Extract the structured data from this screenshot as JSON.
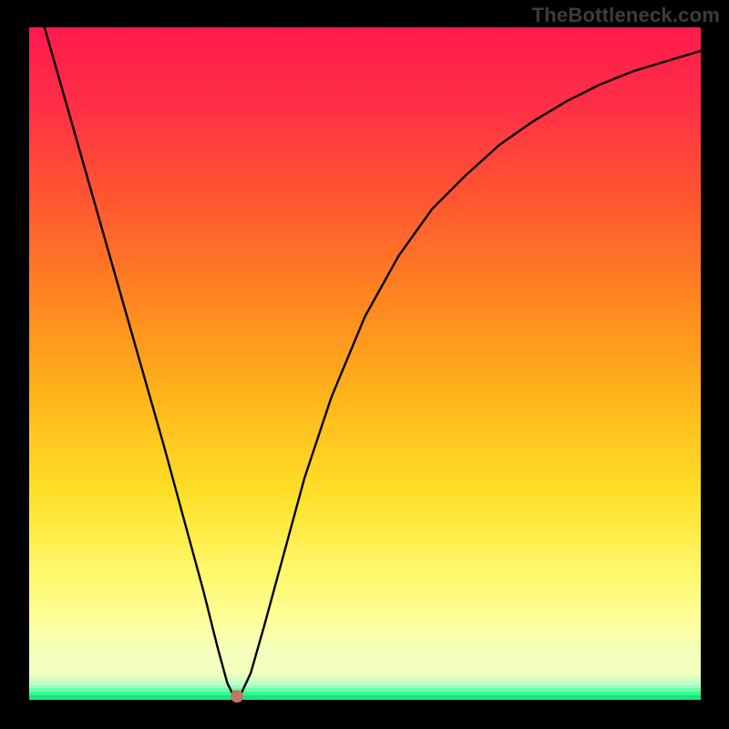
{
  "watermark": "TheBottleneck.com",
  "chart_data": {
    "type": "line",
    "title": "",
    "xlabel": "",
    "ylabel": "",
    "xlim": [
      0,
      100
    ],
    "ylim": [
      0,
      100
    ],
    "series": [
      {
        "name": "curve",
        "x": [
          0,
          4,
          8,
          12,
          16,
          20,
          23,
          26,
          28,
          29.5,
          30.5,
          31.5,
          33,
          35,
          38,
          41,
          45,
          50,
          55,
          60,
          65,
          70,
          75,
          80,
          85,
          90,
          95,
          100
        ],
        "y": [
          108,
          94,
          80,
          66,
          52,
          38,
          27,
          16,
          8,
          2.5,
          0.5,
          0.8,
          4,
          11,
          22,
          33,
          45,
          57,
          66,
          73,
          78,
          82.5,
          86,
          89,
          91.5,
          93.5,
          95,
          96.5
        ]
      }
    ],
    "marker": {
      "x": 31,
      "y": 0.5,
      "color": "#c37664"
    },
    "gradient_bands": [
      {
        "from": 96.5,
        "to": 97.2,
        "color": "#d9ffc2"
      },
      {
        "from": 97.2,
        "to": 97.8,
        "color": "#bfffc8"
      },
      {
        "from": 97.8,
        "to": 98.3,
        "color": "#99ffc1"
      },
      {
        "from": 98.3,
        "to": 98.8,
        "color": "#6cffab"
      },
      {
        "from": 98.8,
        "to": 99.3,
        "color": "#38f994"
      },
      {
        "from": 99.3,
        "to": 100,
        "color": "#14e87b"
      }
    ]
  }
}
